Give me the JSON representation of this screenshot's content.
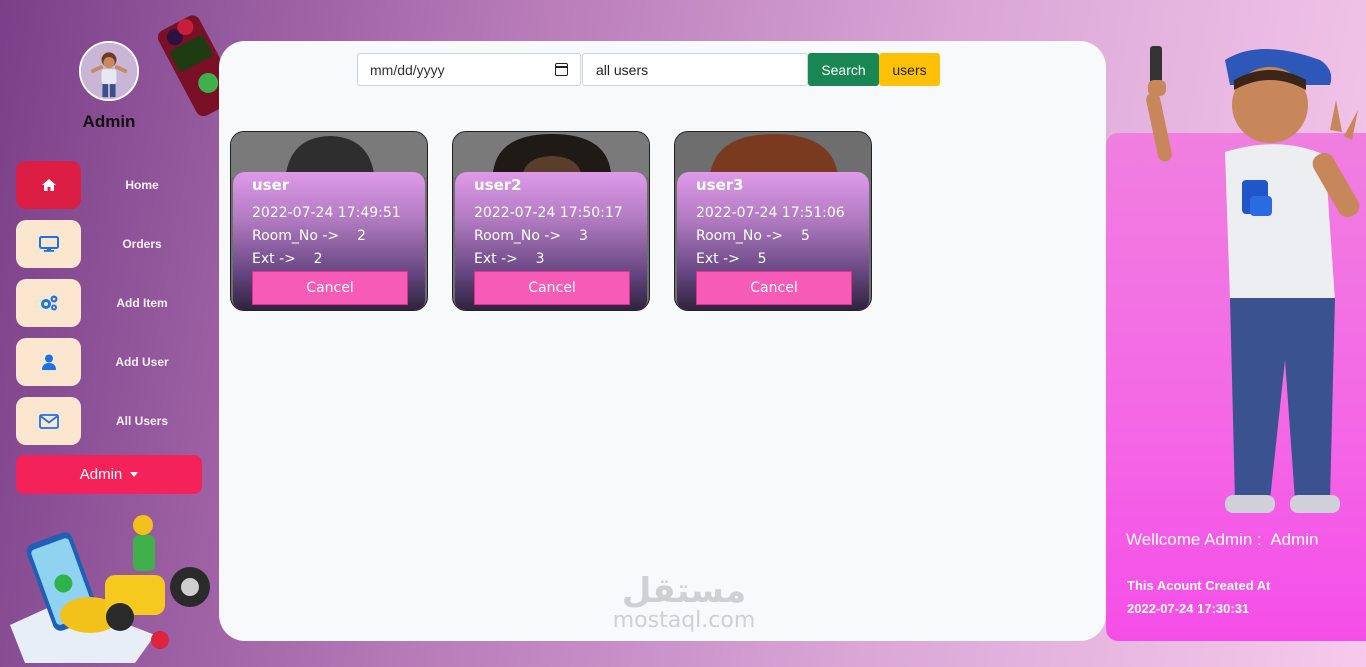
{
  "sidebar": {
    "admin_name": "Admin",
    "items": [
      {
        "label": "Home",
        "icon": "home-icon",
        "active": true
      },
      {
        "label": "Orders",
        "icon": "monitor-icon",
        "active": false
      },
      {
        "label": "Add Item",
        "icon": "gears-icon",
        "active": false
      },
      {
        "label": "Add User",
        "icon": "user-icon",
        "active": false
      },
      {
        "label": "All Users",
        "icon": "envelope-icon",
        "active": false
      }
    ],
    "dropdown_label": "Admin"
  },
  "filters": {
    "date_placeholder": "mm/dd/yyyy",
    "user_select_value": "all users",
    "search_label": "Search",
    "users_label": "users"
  },
  "orders": [
    {
      "name": "user",
      "datetime": "2022-07-24 17:49:51",
      "room_label": "Room_No ->",
      "room": "2",
      "ext_label": "Ext ->",
      "ext": "2",
      "cancel_label": "Cancel"
    },
    {
      "name": "user2",
      "datetime": "2022-07-24 17:50:17",
      "room_label": "Room_No ->",
      "room": "3",
      "ext_label": "Ext ->",
      "ext": "3",
      "cancel_label": "Cancel"
    },
    {
      "name": "user3",
      "datetime": "2022-07-24 17:51:06",
      "room_label": "Room_No ->",
      "room": "5",
      "ext_label": "Ext ->",
      "ext": "5",
      "cancel_label": "Cancel"
    }
  ],
  "watermark": {
    "arabic": "مستقل",
    "latin": "mostaql.com"
  },
  "profile": {
    "welcome_label": "Wellcome Admin :",
    "welcome_name": "Admin",
    "created_label": "This Acount Created At",
    "created_at": "2022-07-24 17:30:31"
  },
  "colors": {
    "accent": "#dc1e45",
    "dropdown": "#f3235a",
    "search": "#198754",
    "users": "#ffc107",
    "cancel": "#f75bb8"
  }
}
